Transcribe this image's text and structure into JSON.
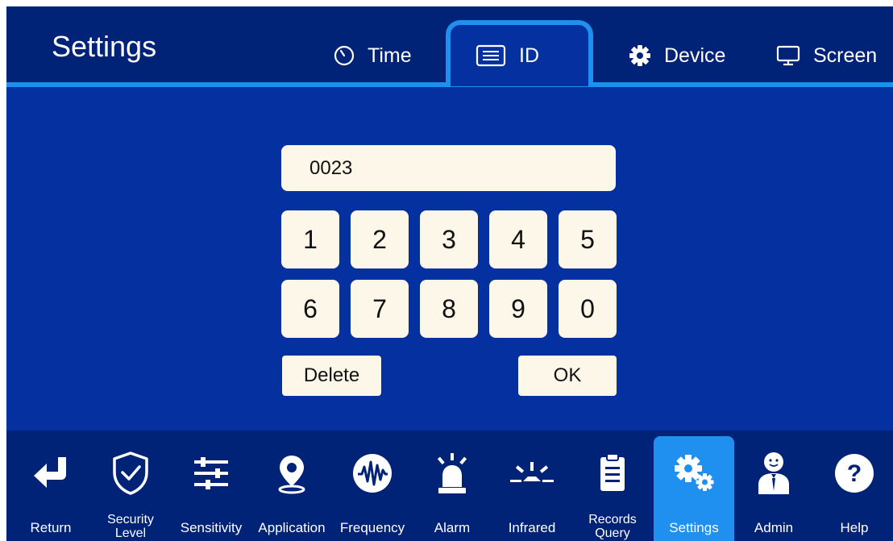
{
  "header": {
    "title": "Settings",
    "tabs": [
      {
        "label": "Time",
        "icon": "clock-icon"
      },
      {
        "label": "ID",
        "icon": "id-card-icon",
        "active": true
      },
      {
        "label": "Device",
        "icon": "gear-icon"
      },
      {
        "label": "Screen",
        "icon": "monitor-icon"
      }
    ]
  },
  "keypad": {
    "input_value": "0023",
    "keys": [
      "1",
      "2",
      "3",
      "4",
      "5",
      "6",
      "7",
      "8",
      "9",
      "0"
    ],
    "delete_label": "Delete",
    "ok_label": "OK"
  },
  "nav": {
    "items": [
      {
        "label": "Return",
        "icon": "return-arrow-icon"
      },
      {
        "label": "Security\nLevel",
        "icon": "shield-check-icon"
      },
      {
        "label": "Sensitivity",
        "icon": "sliders-icon"
      },
      {
        "label": "Application",
        "icon": "location-pin-icon"
      },
      {
        "label": "Frequency",
        "icon": "waveform-icon"
      },
      {
        "label": "Alarm",
        "icon": "alarm-light-icon"
      },
      {
        "label": "Infrared",
        "icon": "infrared-icon"
      },
      {
        "label": "Records\nQuery",
        "icon": "clipboard-icon"
      },
      {
        "label": "Settings",
        "icon": "gears-icon",
        "active": true
      },
      {
        "label": "Admin",
        "icon": "admin-person-icon"
      },
      {
        "label": "Help",
        "icon": "help-icon"
      }
    ]
  },
  "colors": {
    "background": "#0531a0",
    "header": "#002377",
    "accent": "#1f8ff0",
    "key": "#fdf7ea"
  }
}
